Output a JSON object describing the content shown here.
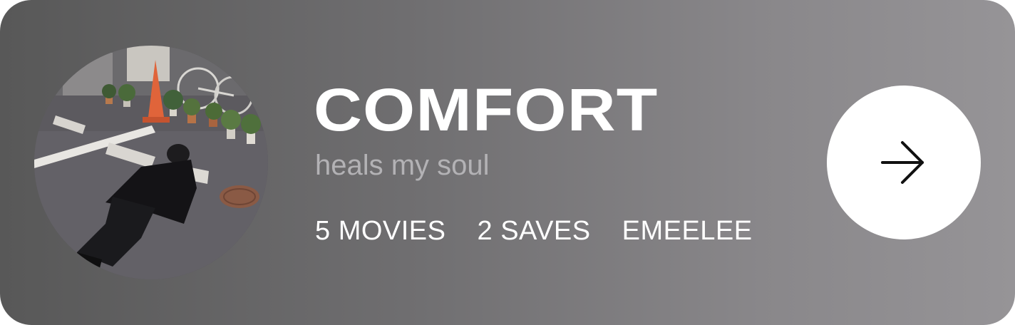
{
  "playlist": {
    "title": "COMFORT",
    "subtitle": "heals my soul",
    "stats": {
      "movies": "5 MOVIES",
      "saves": "2 SAVES",
      "author": "EMEELEE"
    }
  },
  "icons": {
    "open": "arrow-right-icon"
  },
  "colors": {
    "card_gradient_start": "#585858",
    "card_gradient_end": "#969497",
    "title": "#ffffff",
    "subtitle": "#b3b2b5",
    "button": "#ffffff",
    "arrow": "#111111"
  }
}
